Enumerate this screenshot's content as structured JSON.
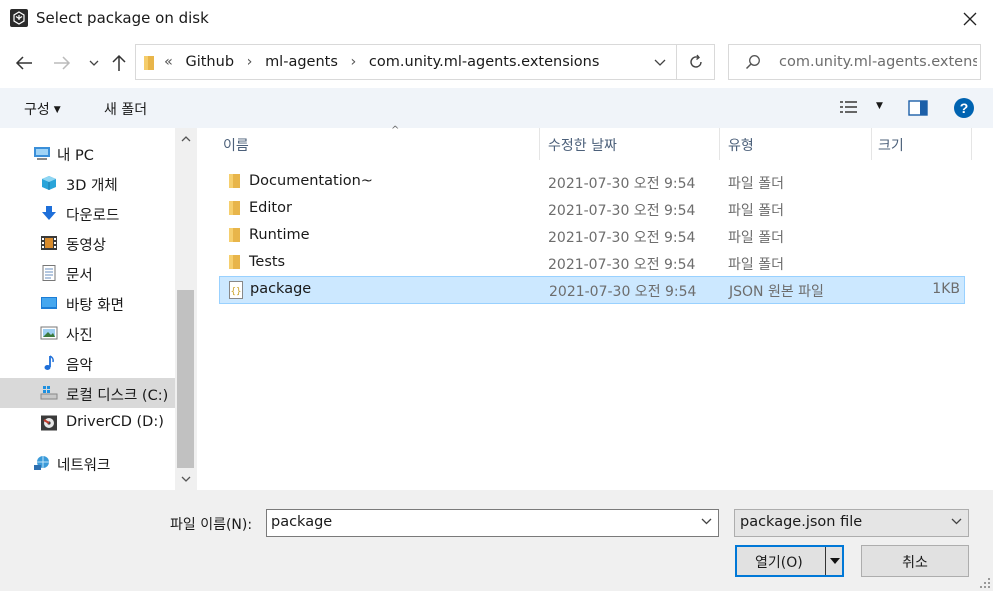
{
  "window": {
    "title": "Select package on disk"
  },
  "address": {
    "overflow": "«",
    "crumbs": [
      "Github",
      "ml-agents",
      "com.unity.ml-agents.extensions"
    ],
    "search_placeholder": "com.unity.ml-agents.extensi..."
  },
  "toolbar": {
    "organize": "구성",
    "new_folder": "새 폴더"
  },
  "nav": {
    "items": [
      {
        "label": "내 PC",
        "icon": "pc-icon"
      },
      {
        "label": "3D 개체",
        "icon": "3d-objects-icon"
      },
      {
        "label": "다운로드",
        "icon": "download-icon"
      },
      {
        "label": "동영상",
        "icon": "video-icon"
      },
      {
        "label": "문서",
        "icon": "document-icon"
      },
      {
        "label": "바탕 화면",
        "icon": "desktop-icon"
      },
      {
        "label": "사진",
        "icon": "pictures-icon"
      },
      {
        "label": "음악",
        "icon": "music-icon"
      },
      {
        "label": "로컬 디스크 (C:)",
        "icon": "local-disk-icon"
      },
      {
        "label": "DriverCD (D:)",
        "icon": "cd-drive-icon"
      },
      {
        "label": "네트워크",
        "icon": "network-icon"
      }
    ],
    "selected": "로컬 디스크 (C:)"
  },
  "columns": {
    "name": "이름",
    "date": "수정한 날짜",
    "type": "유형",
    "size": "크기"
  },
  "files": [
    {
      "name": "Documentation~",
      "date": "2021-07-30 오전 9:54",
      "type": "파일 폴더",
      "size": "",
      "icon": "folder-icon"
    },
    {
      "name": "Editor",
      "date": "2021-07-30 오전 9:54",
      "type": "파일 폴더",
      "size": "",
      "icon": "folder-icon"
    },
    {
      "name": "Runtime",
      "date": "2021-07-30 오전 9:54",
      "type": "파일 폴더",
      "size": "",
      "icon": "folder-icon"
    },
    {
      "name": "Tests",
      "date": "2021-07-30 오전 9:54",
      "type": "파일 폴더",
      "size": "",
      "icon": "folder-icon"
    },
    {
      "name": "package",
      "date": "2021-07-30 오전 9:54",
      "type": "JSON 원본 파일",
      "size": "1KB",
      "icon": "json-file-icon"
    }
  ],
  "selected_file": "package",
  "footer": {
    "filename_label": "파일 이름(N):",
    "filename_value": "package",
    "filetype_value": "package.json file",
    "open_label": "열기(O)",
    "cancel_label": "취소"
  },
  "colors": {
    "accent": "#0078d7",
    "selection": "#cce8ff",
    "selection_border": "#99d1ff",
    "folder": "#e8b54a",
    "help": "#0063b1"
  }
}
